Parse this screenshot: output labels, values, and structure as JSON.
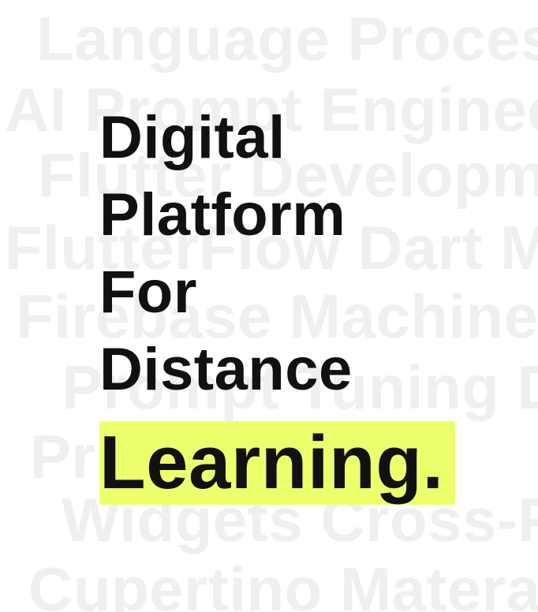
{
  "background_words": [
    "Language Process",
    "AI Prompt Engineeri",
    "Flutter Developme",
    "FlutterFlow  Dart  Ma",
    "Firebase Machine L",
    "Prompt Tuning Da",
    "Pr                         ne T",
    "Widgets Cross-Pla",
    "Cupertino Materail"
  ],
  "headline": {
    "line1": "Digital",
    "line2": "Platform",
    "line3": "For",
    "line4": "Distance",
    "highlight": "Learning."
  },
  "colors": {
    "background": "#ffffff",
    "background_text": "#efefef",
    "headline_text": "#111111",
    "highlight": "#eeff6e"
  }
}
